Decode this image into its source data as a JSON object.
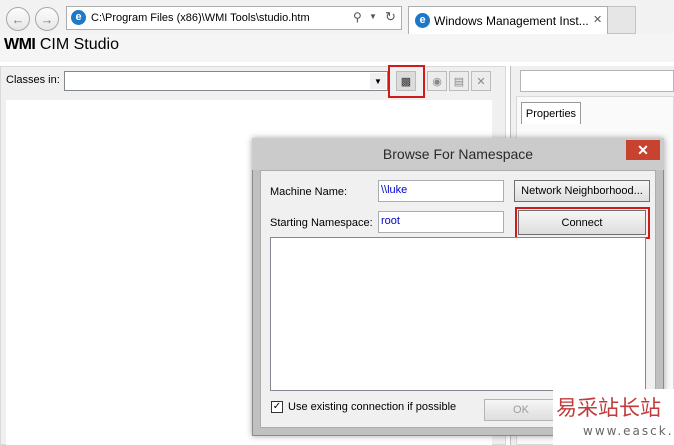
{
  "browser": {
    "address": "C:\\Program Files (x86)\\WMI Tools\\studio.htm",
    "tab_title": "Windows Management Inst...",
    "back_icon": "back-arrow-icon",
    "forward_icon": "forward-arrow-icon"
  },
  "app": {
    "title_bold": "WMI",
    "title_rest": " CIM Studio",
    "classes_label": "Classes in:",
    "classes_value": "",
    "properties_tab": "Properties"
  },
  "dialog": {
    "title": "Browse For Namespace",
    "close_glyph": "✕",
    "machine_label": "Machine Name:",
    "machine_value": "\\\\luke",
    "network_button": "Network Neighborhood...",
    "namespace_label": "Starting Namespace:",
    "namespace_value": "root",
    "connect_button": "Connect",
    "checkbox_checked": true,
    "checkbox_label": "Use existing connection if possible",
    "ok_button": "OK"
  },
  "highlight_color": "#d11a1a",
  "watermark": {
    "text": "易采站长站",
    "url": "www.easck.com"
  }
}
